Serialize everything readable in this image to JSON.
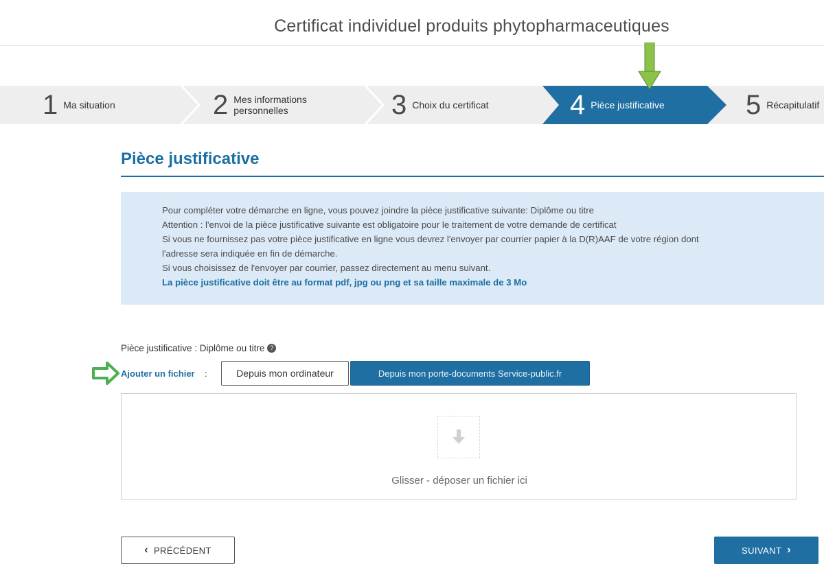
{
  "header": {
    "title": "Certificat individuel produits phytopharmaceutiques"
  },
  "stepper": {
    "steps": [
      {
        "number": "1",
        "label_line1": "Ma situation",
        "label_line2": ""
      },
      {
        "number": "2",
        "label_line1": "Mes informations",
        "label_line2": "personnelles"
      },
      {
        "number": "3",
        "label_line1": "Choix du certificat",
        "label_line2": ""
      },
      {
        "number": "4",
        "label_line1": "Pièce justificative",
        "label_line2": ""
      },
      {
        "number": "5",
        "label_line1": "Récapitulatif",
        "label_line2": ""
      }
    ],
    "active_index": 3
  },
  "section": {
    "title": "Pièce justificative"
  },
  "info": {
    "lines": [
      "Pour compléter votre démarche en ligne, vous pouvez joindre la pièce justificative suivante: Diplôme ou titre",
      "Attention : l'envoi de la pièce justificative suivante est obligatoire pour le traitement de votre demande de certificat",
      "Si vous ne fournissez pas votre pièce justificative en ligne vous devrez l'envoyer par courrier papier à la D(R)AAF de votre région dont",
      "l'adresse sera indiquée en fin de démarche.",
      "Si vous choisissez de l'envoyer par courrier, passez directement au menu suivant."
    ],
    "bold_line": "La pièce justificative doit être au format pdf, jpg ou png et sa taille maximale de 3 Mo"
  },
  "upload": {
    "field_label": "Pièce justificative : Diplôme ou titre",
    "help_icon": "question-icon",
    "add_label": "Ajouter un fichier",
    "add_colon": ":",
    "btn_computer": "Depuis mon ordinateur",
    "btn_service_public": "Depuis mon porte-documents Service-public.fr",
    "dropzone_icon": "download-arrow-icon",
    "dropzone_text": "Glisser - déposer un fichier ici"
  },
  "nav": {
    "prev_label": "PRÉCÉDENT",
    "prev_icon": "chevron-left-icon",
    "next_label": "SUIVANT",
    "next_icon": "chevron-right-icon"
  },
  "annotations": {
    "arrow_color": "#6aa84f",
    "arrow_color_down": "#8bc34a"
  },
  "colors": {
    "primary": "#1f6fa3",
    "info_bg": "#dce9f6",
    "stepper_bg": "#eeeeee"
  }
}
